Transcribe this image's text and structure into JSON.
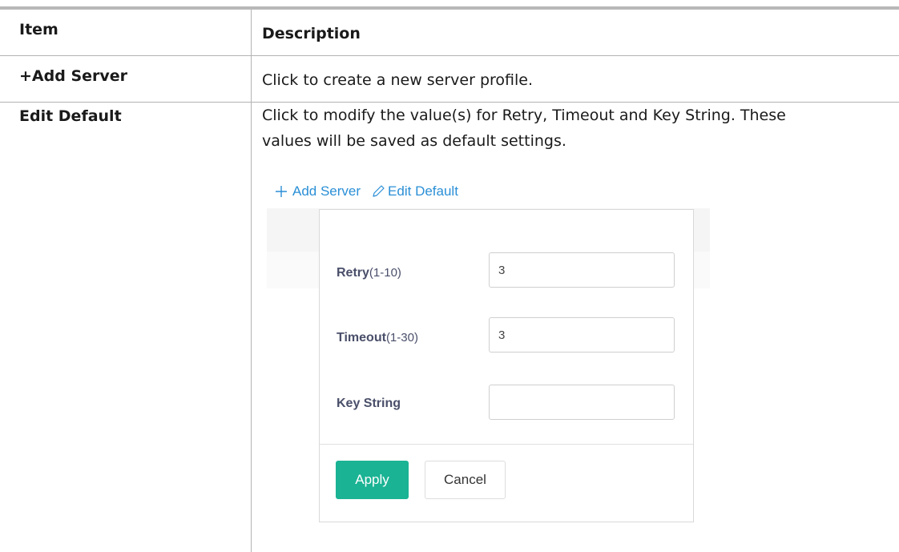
{
  "table": {
    "header": {
      "item": "Item",
      "description": "Description"
    },
    "rows": [
      {
        "item": "+Add Server",
        "description": "Click to create a new server profile."
      },
      {
        "item": "Edit Default",
        "description_line1": "Click to modify the value(s) for Retry, Timeout and Key String. These",
        "description_line2": "values will be saved as default settings."
      }
    ]
  },
  "screenshot": {
    "toolbar": {
      "add_label": "Add Server",
      "edit_label": "Edit Default",
      "add_icon": "plus-icon",
      "edit_icon": "pencil-icon",
      "link_color": "#2a8fd6"
    },
    "dialog": {
      "fields": [
        {
          "label": "Retry",
          "range": "(1-10)",
          "value": "3"
        },
        {
          "label": "Timeout",
          "range": "(1-30)",
          "value": "3"
        },
        {
          "label": "Key String",
          "range": "",
          "value": ""
        }
      ],
      "apply_label": "Apply",
      "cancel_label": "Cancel",
      "apply_color": "#1ab394"
    }
  }
}
